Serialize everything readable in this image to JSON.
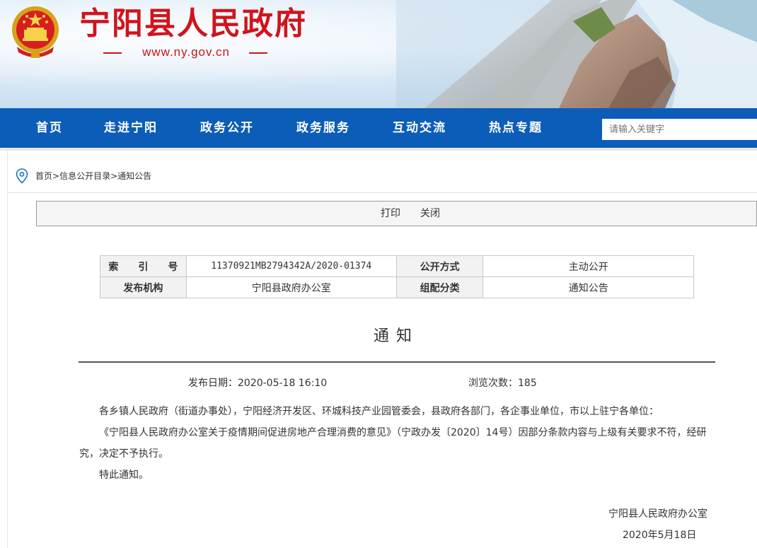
{
  "header": {
    "site_title": "宁阳县人民政府",
    "site_url": "www.ny.gov.cn"
  },
  "nav": {
    "items": [
      "首页",
      "走进宁阳",
      "政务公开",
      "政务服务",
      "互动交流",
      "热点专题"
    ],
    "search_placeholder": "请输入关键字"
  },
  "breadcrumb": {
    "items": [
      "首页",
      "信息公开目录",
      "通知公告"
    ],
    "separator": ">"
  },
  "toolbar": {
    "print": "打印",
    "close": "关闭"
  },
  "info": {
    "index_label": "索　　引　　号",
    "index_value": "11370921MB2794342A/2020-01374",
    "disclosure_label": "公开方式",
    "disclosure_value": "主动公开",
    "issuer_label": "发布机构",
    "issuer_value": "宁阳县政府办公室",
    "category_label": "组配分类",
    "category_value": "通知公告"
  },
  "article": {
    "title": "通知",
    "publish_date": "发布日期：2020-05-18 16:10",
    "views": "浏览次数：185",
    "paragraphs": [
      "各乡镇人民政府（街道办事处），宁阳经济开发区、环城科技产业园管委会，县政府各部门，各企事业单位，市以上驻宁各单位：",
      "《宁阳县人民政府办公室关于疫情期间促进房地产合理消费的意见》（宁政办发〔2020〕14号）因部分条款内容与上级有关要求不符，经研究，决定不予执行。",
      "特此通知。"
    ],
    "signature": "宁阳县人民政府办公室",
    "signature_date": "2020年5月18日"
  },
  "colors": {
    "brand_red": "#d0141d",
    "nav_blue": "#0b5db8"
  }
}
